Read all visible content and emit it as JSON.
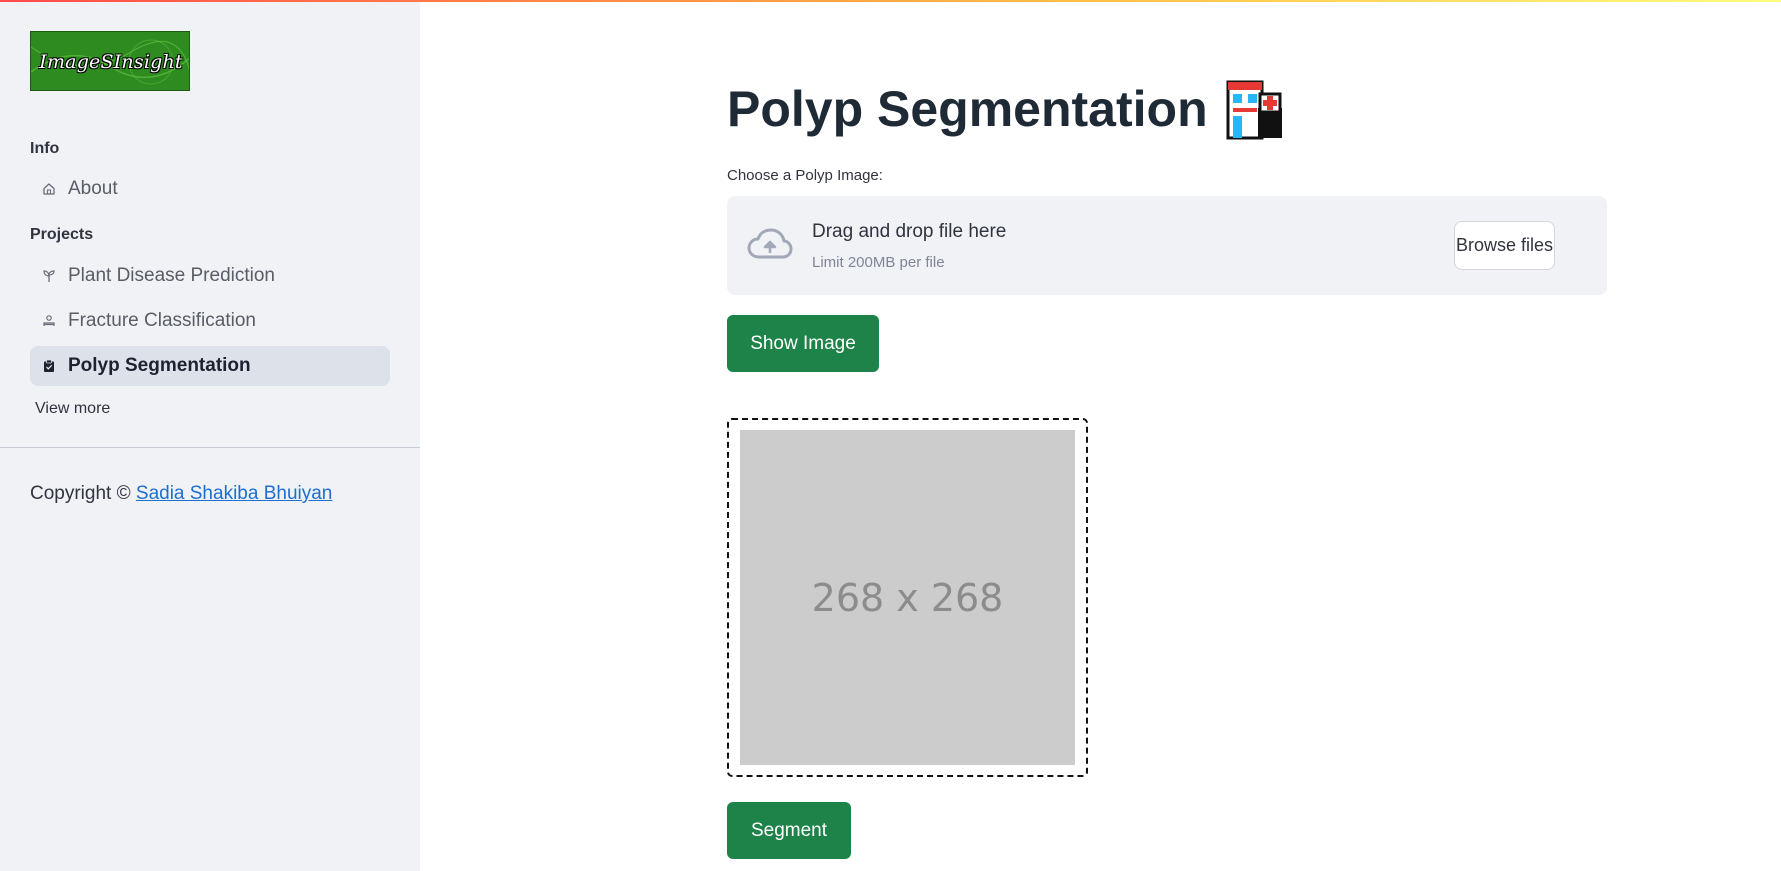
{
  "logo": {
    "text": "ImageSInsight"
  },
  "sidebar": {
    "sections": [
      {
        "label": "Info"
      },
      {
        "label": "Projects"
      }
    ],
    "items": [
      {
        "label": "About",
        "icon": "home-icon"
      },
      {
        "label": "Plant Disease Prediction",
        "icon": "sprout-icon"
      },
      {
        "label": "Fracture Classification",
        "icon": "person-bed-icon"
      },
      {
        "label": "Polyp Segmentation",
        "icon": "clipboard-icon",
        "active": true
      }
    ],
    "view_more": "View more",
    "copyright_prefix": "Copyright ©",
    "copyright_author": "Sadia Shakiba Bhuiyan"
  },
  "main": {
    "title": "Polyp Segmentation",
    "title_icon": "hospital-emoji",
    "uploader": {
      "label": "Choose a Polyp Image:",
      "drop_text": "Drag and drop file here",
      "limit_text": "Limit 200MB per file",
      "browse_label": "Browse files"
    },
    "show_image_label": "Show Image",
    "placeholder_text": "268 x 268",
    "segment_label": "Segment"
  },
  "colors": {
    "accent_green": "#1e8349",
    "sidebar_bg": "#f0f2f6",
    "link_blue": "#1c6fcf"
  }
}
